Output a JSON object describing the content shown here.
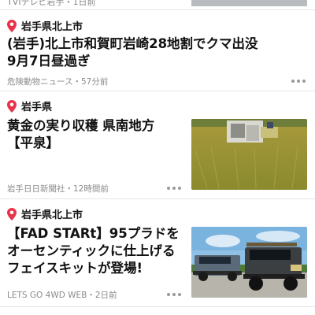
{
  "top_partial": {
    "meta": "TVIテレビ岩手・1日前"
  },
  "articles": [
    {
      "location": "岩手県北上市",
      "title_lines": [
        "(岩手)北上市和賀町岩崎28地割でクマ出没",
        "9月7日昼過ぎ"
      ],
      "source_time": "危険動物ニュース・57分前",
      "has_thumbnail": false
    },
    {
      "location": "岩手県",
      "title_lines": [
        "黄金の実り収穫 県南地方",
        "【平泉】"
      ],
      "source_time": "岩手日日新聞社・12時間前",
      "has_thumbnail": true,
      "thumbnail": "rice-harvest-photo"
    },
    {
      "location": "岩手県北上市",
      "title_lines": [
        "【FAD STARt】95プラドを",
        "オーセンティックに仕上げる",
        "フェイスキットが登場!"
      ],
      "source_time": "LETS GO 4WD WEB・2日前",
      "has_thumbnail": true,
      "thumbnail": "land-cruiser-photo"
    }
  ],
  "icons": {
    "location": "map-pin-icon",
    "more": "more-options-icon"
  },
  "colors": {
    "pin": "#e8334a",
    "meta": "#8a8a8a",
    "divider": "#e6e6e6"
  }
}
